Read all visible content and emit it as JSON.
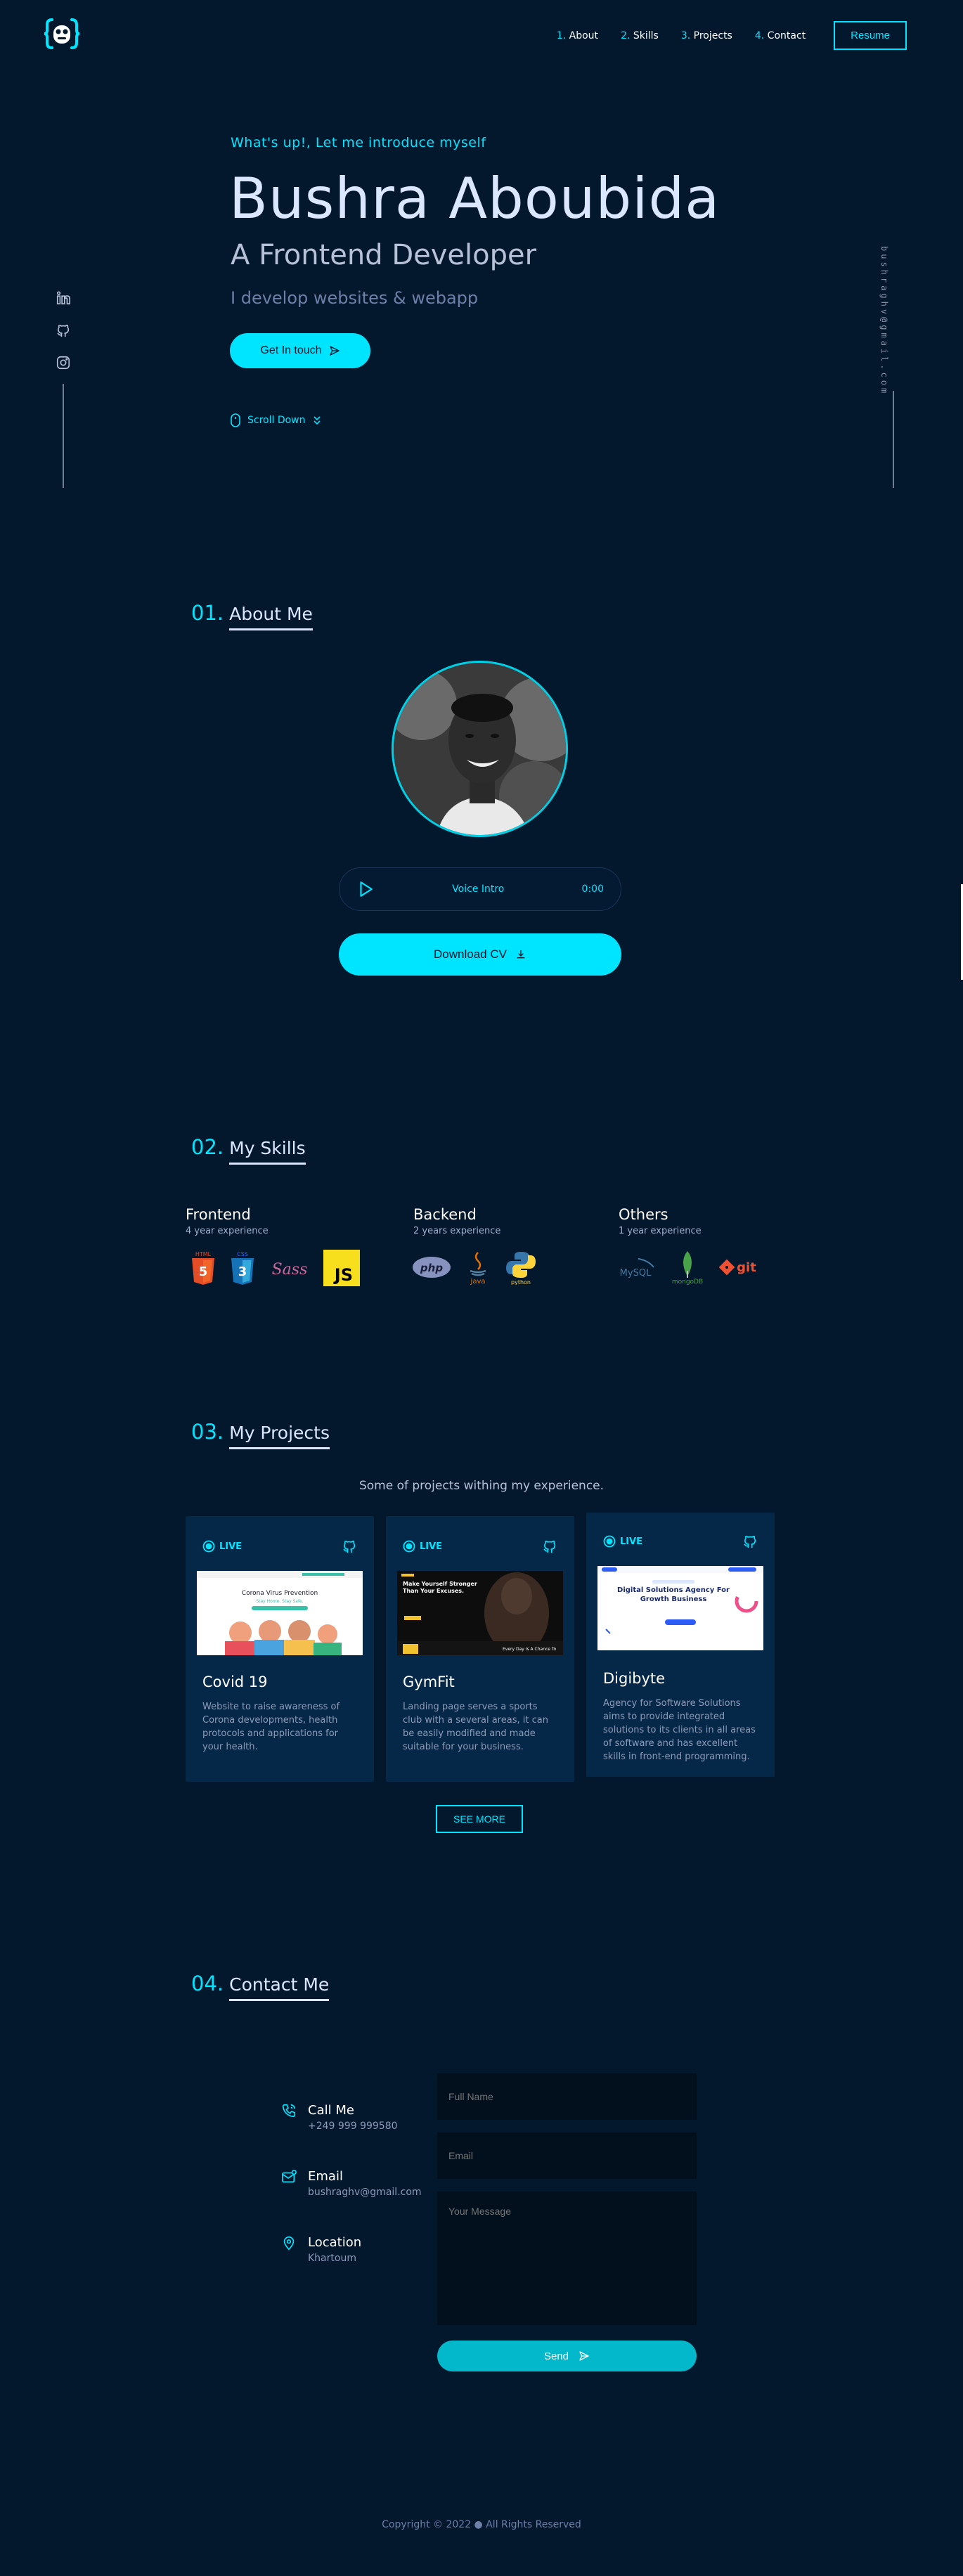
{
  "nav": {
    "links": [
      {
        "num": "1.",
        "label": "About"
      },
      {
        "num": "2.",
        "label": "Skills"
      },
      {
        "num": "3.",
        "label": "Projects"
      },
      {
        "num": "4.",
        "label": "Contact"
      }
    ],
    "resume_label": "Resume"
  },
  "sidebar": {
    "email": "bushraghv@gmail.com"
  },
  "hero": {
    "greeting": "What's up!, Let me introduce myself",
    "name": "Bushra Aboubida",
    "role": "A Frontend Developer",
    "tagline": "I develop websites & webapp",
    "cta_label": "Get In touch",
    "scroll_label": "Scroll Down"
  },
  "about": {
    "num": "01.",
    "title": "About Me",
    "voice_label": "Voice Intro",
    "voice_time": "0:00",
    "download_label": "Download CV"
  },
  "skills": {
    "num": "02.",
    "title": "My Skills",
    "groups": [
      {
        "name": "Frontend",
        "exp": "4 year experience",
        "logos": [
          "HTML",
          "CSS",
          "Sass",
          "JS"
        ]
      },
      {
        "name": "Backend",
        "exp": "2 years experience",
        "logos": [
          "php",
          "Java",
          "python"
        ]
      },
      {
        "name": "Others",
        "exp": "1 year experience",
        "logos": [
          "MySQL",
          "mongoDB",
          "git"
        ]
      }
    ]
  },
  "projects": {
    "num": "03.",
    "title": "My Projects",
    "subtitle": "Some of projects withing my experience.",
    "live_label": "LIVE",
    "items": [
      {
        "title": "Covid 19",
        "desc": "Website to raise awareness of Corona developments, health protocols and applications for your health.",
        "shot_heading": "Corona Virus Prevention",
        "shot_sub": "Stay Home. Stay Safe."
      },
      {
        "title": "GymFit",
        "desc": "Landing page serves a sports club with a several areas, it can be easily modified and made suitable for your business.",
        "shot_heading": "Make Yourself Stronger Than Your Excuses.",
        "shot_sub": "Every Day Is A Chance To"
      },
      {
        "title": "Digibyte",
        "desc": "Agency for Software Solutions aims to provide integrated solutions to its clients in all areas of software and has excellent skills in front-end programming.",
        "shot_heading": "Digital Solutions Agency For Growth Business",
        "shot_sub": ""
      }
    ],
    "see_more_label": "SEE MORE"
  },
  "contact": {
    "num": "04.",
    "title": "Contact Me",
    "items": [
      {
        "name": "Call Me",
        "value": "+249 999 999580"
      },
      {
        "name": "Email",
        "value": "bushraghv@gmail.com"
      },
      {
        "name": "Location",
        "value": "Khartoum"
      }
    ],
    "form": {
      "name_placeholder": "Full Name",
      "email_placeholder": "Email",
      "message_placeholder": "Your Message",
      "send_label": "Send"
    }
  },
  "footer": {
    "copyright": "Copyright © 2022 ● All Rights Reserved"
  },
  "colors": {
    "background": "#03172d",
    "accent": "#00e5ff",
    "card": "#062848",
    "field": "#020f1c"
  }
}
